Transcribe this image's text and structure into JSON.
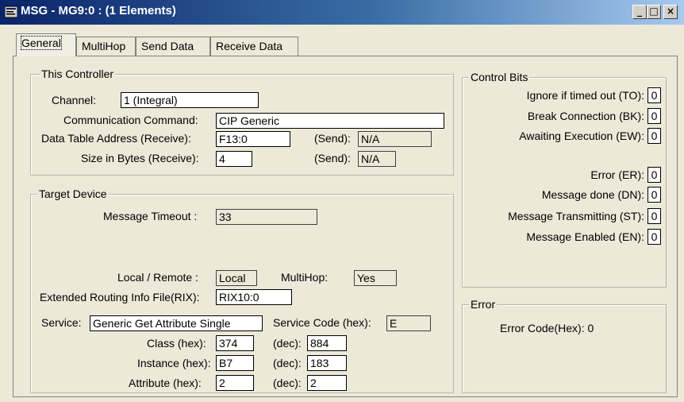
{
  "window": {
    "title": "MSG - MG9:0 : (1 Elements)"
  },
  "tabs": [
    "General",
    "MultiHop",
    "Send Data",
    "Receive Data"
  ],
  "this_controller": {
    "title": "This Controller",
    "channel_label": "Channel:",
    "channel_value": "1 (Integral)",
    "comm_label": "Communication Command:",
    "comm_value": "CIP Generic",
    "dta_label": "Data Table Address (Receive):",
    "dta_value": "F13:0",
    "dta_send_label": "(Send):",
    "dta_send_value": "N/A",
    "size_label": "Size in Bytes (Receive):",
    "size_value": "4",
    "size_send_label": "(Send):",
    "size_send_value": "N/A"
  },
  "target_device": {
    "title": "Target Device",
    "timeout_label": "Message Timeout :",
    "timeout_value": "33",
    "local_label": "Local / Remote :",
    "local_value": "Local",
    "multihop_label": "MultiHop:",
    "multihop_value": "Yes",
    "rix_label": "Extended Routing Info File(RIX):",
    "rix_value": "RIX10:0",
    "service_label": "Service:",
    "service_value": "Generic Get Attribute Single",
    "service_code_label": "Service Code (hex):",
    "service_code_value": "E",
    "class_label": "Class (hex):",
    "class_hex": "374",
    "class_dec_label": "(dec):",
    "class_dec": "884",
    "instance_label": "Instance (hex):",
    "instance_hex": "B7",
    "instance_dec_label": "(dec):",
    "instance_dec": "183",
    "attribute_label": "Attribute (hex):",
    "attribute_hex": "2",
    "attribute_dec_label": "(dec):",
    "attribute_dec": "2"
  },
  "control_bits": {
    "title": "Control Bits",
    "to_label": "Ignore if timed out (TO):",
    "to_value": "0",
    "bk_label": "Break Connection (BK):",
    "bk_value": "0",
    "ew_label": "Awaiting Execution (EW):",
    "ew_value": "0",
    "er_label": "Error (ER):",
    "er_value": "0",
    "dn_label": "Message done (DN):",
    "dn_value": "0",
    "st_label": "Message Transmitting (ST):",
    "st_value": "0",
    "en_label": "Message Enabled (EN):",
    "en_value": "0"
  },
  "error": {
    "title": "Error",
    "code_label": "Error Code(Hex): 0"
  }
}
